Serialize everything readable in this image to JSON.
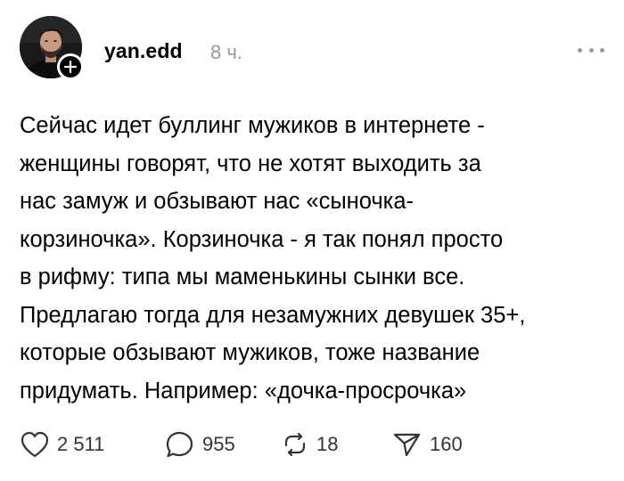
{
  "post": {
    "author": {
      "username": "yan.edd",
      "avatar": "avatar-photo",
      "follow_icon": "plus-icon"
    },
    "time": "8 ч.",
    "more_icon": "more-dots-icon",
    "text_lines": [
      "Сейчас идет буллинг мужиков в интернете -",
      "женщины говорят, что не хотят выходить за",
      "нас замуж и обзывают нас «сыночка-",
      "корзиночка». Корзиночка - я так понял просто",
      "в рифму: типа мы маменькины сынки все.",
      "Предлагаю тогда для незамужних девушек 35+,",
      "которые обзывают мужиков, тоже название",
      "придумать. Например: «дочка-просрочка»"
    ],
    "actions": {
      "likes": {
        "icon": "heart-icon",
        "count": "2 511"
      },
      "replies": {
        "icon": "comment-icon",
        "count": "955"
      },
      "reposts": {
        "icon": "repost-icon",
        "count": "18"
      },
      "shares": {
        "icon": "send-icon",
        "count": "160"
      }
    }
  },
  "colors": {
    "text": "#000000",
    "muted": "#999999",
    "icon": "#333333",
    "background": "#ffffff"
  }
}
